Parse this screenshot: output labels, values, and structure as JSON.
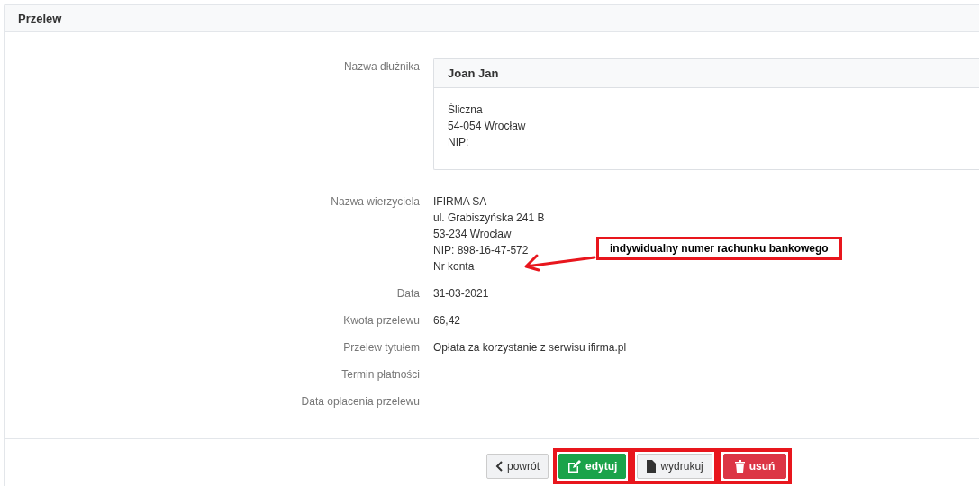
{
  "panel": {
    "title": "Przelew"
  },
  "debtor": {
    "label": "Nazwa dłużnika",
    "name": "Joan Jan",
    "lines": [
      "Śliczna",
      "54-054 Wrocław",
      "NIP:"
    ]
  },
  "creditor": {
    "label": "Nazwa wierzyciela",
    "lines": [
      "IFIRMA SA",
      "ul. Grabiszyńska 241 B",
      "53-234 Wrocław",
      "NIP: 898-16-47-572",
      "Nr konta"
    ]
  },
  "fields": [
    {
      "label": "Data",
      "value": "31-03-2021"
    },
    {
      "label": "Kwota przelewu",
      "value": "66,42"
    },
    {
      "label": "Przelew tytułem",
      "value": "Opłata za korzystanie z serwisu ifirma.pl"
    },
    {
      "label": "Termin płatności"
    },
    {
      "label": "Data opłacenia przelewu"
    }
  ],
  "annotation": {
    "text": "indywidualny numer rachunku bankowego"
  },
  "buttons": [
    {
      "label": "powrót",
      "kind": "back",
      "highlighted": false
    },
    {
      "label": "edytuj",
      "kind": "edit",
      "highlighted": true
    },
    {
      "label": "wydrukuj",
      "kind": "print",
      "highlighted": true
    },
    {
      "label": "usuń",
      "kind": "delete",
      "highlighted": true
    }
  ]
}
